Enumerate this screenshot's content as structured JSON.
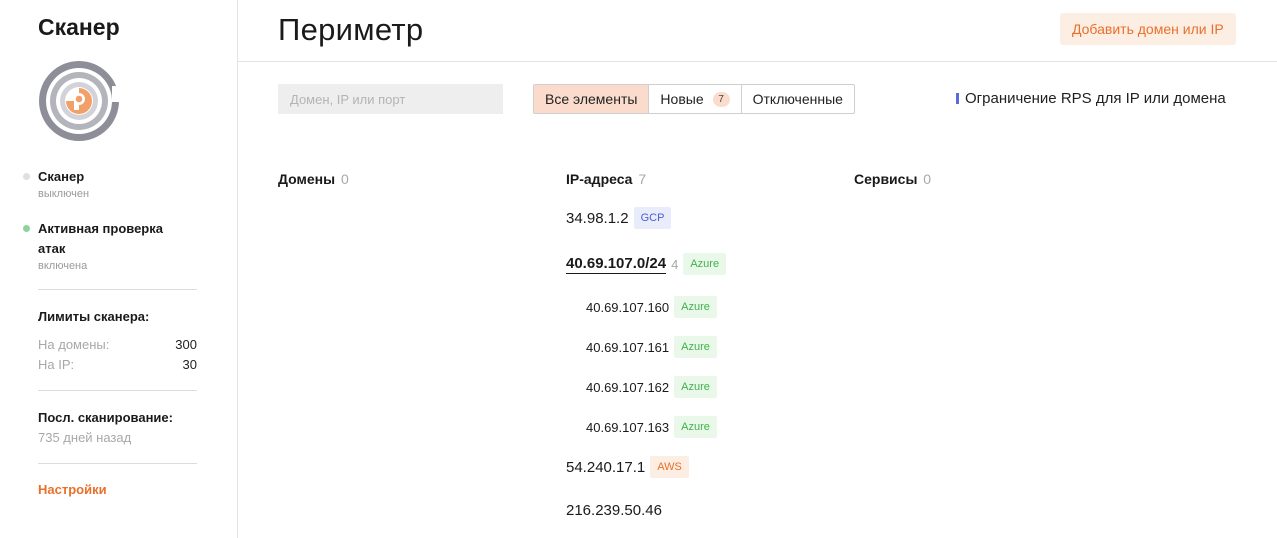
{
  "sidebar": {
    "title": "Сканер",
    "scanner": {
      "name": "Сканер",
      "status": "выключен",
      "dot_color": "#e0e0e0"
    },
    "active_check": {
      "name": "Активная проверка атак",
      "status": "включена",
      "dot_color": "#8fd39a"
    },
    "limits": {
      "title": "Лимиты сканера:",
      "domains_label": "На домены:",
      "domains_value": "300",
      "ip_label": "На IP:",
      "ip_value": "30"
    },
    "last_scan": {
      "title": "Посл. сканирование:",
      "value": "735 дней назад"
    },
    "settings_label": "Настройки"
  },
  "header": {
    "title": "Периметр",
    "add_button": "Добавить домен или IP"
  },
  "toolbar": {
    "search_placeholder": "Домен, IP или порт",
    "search_value": "",
    "filters": [
      {
        "label": "Все элементы",
        "active": true
      },
      {
        "label": "Новые",
        "badge": "7"
      },
      {
        "label": "Отключенные"
      }
    ],
    "rps_label": "Ограничение RPS для IP или домена"
  },
  "columns": {
    "domains": {
      "title": "Домены",
      "count": "0"
    },
    "ips": {
      "title": "IP-адреса",
      "count": "7"
    },
    "services": {
      "title": "Сервисы",
      "count": "0"
    }
  },
  "ip_list": [
    {
      "ip": "34.98.1.2",
      "provider": "GCP"
    },
    {
      "ip": "40.69.107.0/24",
      "count": "4",
      "provider": "Azure",
      "subnet": true
    },
    {
      "ip": "40.69.107.160",
      "provider": "Azure"
    },
    {
      "ip": "40.69.107.161",
      "provider": "Azure"
    },
    {
      "ip": "40.69.107.162",
      "provider": "Azure"
    },
    {
      "ip": "40.69.107.163",
      "provider": "Azure"
    },
    {
      "ip": "54.240.17.1",
      "provider": "AWS"
    },
    {
      "ip": "216.239.50.46",
      "provider": ""
    }
  ],
  "colors": {
    "accent": "#e8702a",
    "rps_marker": "#5c6bd8"
  }
}
